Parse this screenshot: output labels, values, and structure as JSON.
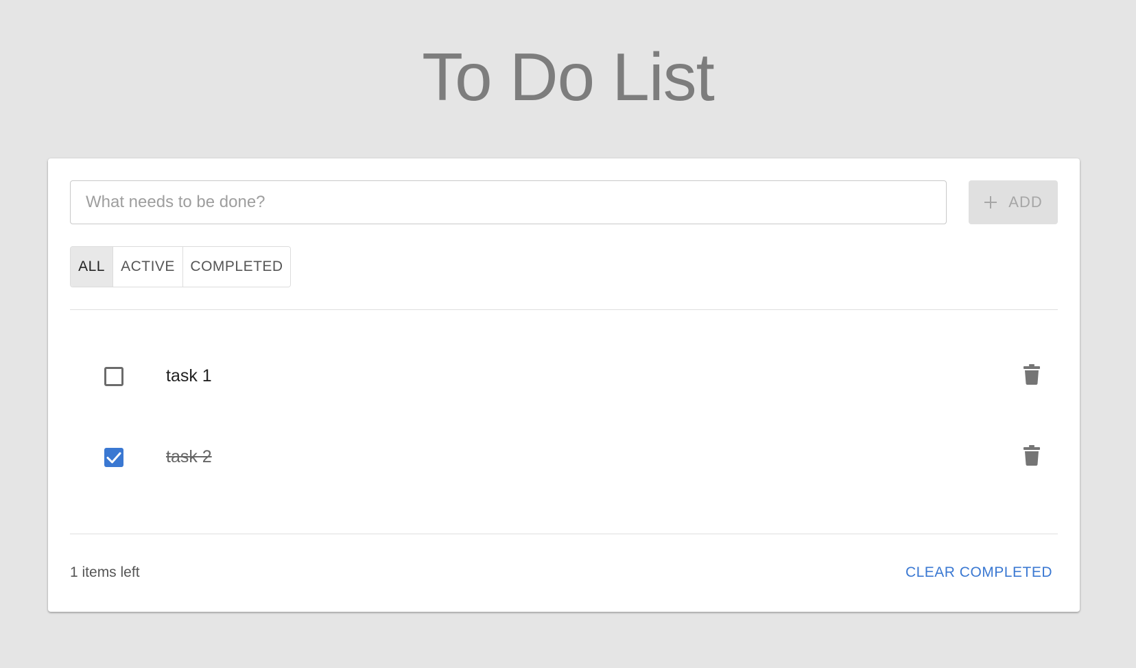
{
  "header": {
    "title": "To Do List"
  },
  "new_todo": {
    "placeholder": "What needs to be done?",
    "value": ""
  },
  "add_button": {
    "label": "ADD",
    "icon": "plus-icon"
  },
  "filters": [
    {
      "label": "ALL",
      "active": true
    },
    {
      "label": "ACTIVE",
      "active": false
    },
    {
      "label": "COMPLETED",
      "active": false
    }
  ],
  "todos": [
    {
      "text": "task 1",
      "completed": false
    },
    {
      "text": "task 2",
      "completed": true
    }
  ],
  "footer": {
    "items_left": "1 items left",
    "clear_completed": "CLEAR COMPLETED"
  },
  "colors": {
    "background": "#e5e5e5",
    "accent": "#3a78d2",
    "title": "#7d7d7d"
  }
}
